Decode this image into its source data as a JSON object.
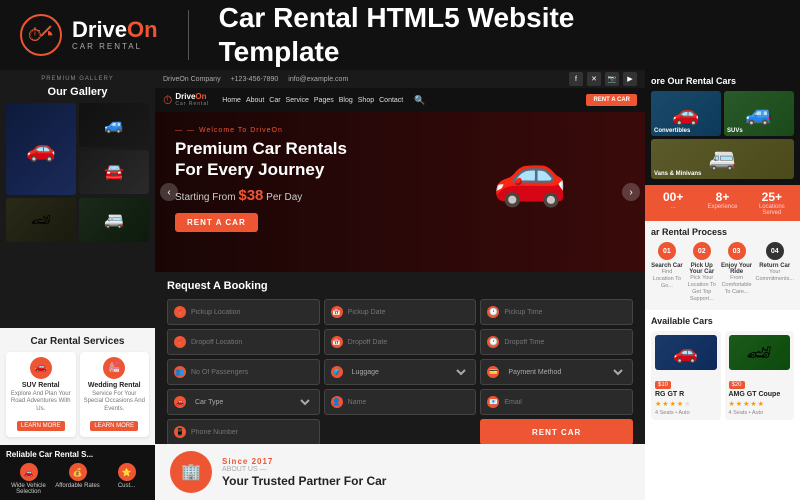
{
  "header": {
    "logo": {
      "drive": "Drive",
      "on": "On",
      "subtitle": "CAR RENTAL"
    },
    "title_line1": "Car Rental HTML5 Website",
    "title_line2": "Template"
  },
  "gallery": {
    "label": "PREMIUM GALLERY",
    "title": "Our Gallery"
  },
  "services": {
    "section_title": "Car Rental Services",
    "items": [
      {
        "icon": "🚗",
        "title": "SUV Rental",
        "desc": "Explore And Plan Your Road Adventures With Us.",
        "btn": "LEARN MORE"
      },
      {
        "icon": "💒",
        "title": "Wedding Rental",
        "desc": "Service For Your Special Occasions And Events.",
        "btn": "LEARN MORE"
      }
    ]
  },
  "reliable": {
    "title": "Reliable Car Rental S...",
    "features": [
      {
        "icon": "🚗",
        "label": "Wide Vehicle Selection"
      },
      {
        "icon": "💰",
        "label": "Affordable Rates"
      },
      {
        "icon": "🛠",
        "label": "Cust..."
      }
    ]
  },
  "mini_nav": {
    "company": "DriveOn Company",
    "phone": "+123-456-7890",
    "email": "info@example.com",
    "links": [
      "Home",
      "About",
      "Car",
      "Service",
      "Pages",
      "Blog",
      "Shop",
      "Contact"
    ],
    "rent_btn": "RENT A CAR",
    "logo_drive": "Drive",
    "logo_on": "On",
    "logo_sub": "Car Rental"
  },
  "hero": {
    "badge": "Welcome To DriveOn",
    "title": "Premium Car Rentals For Every Journey",
    "price_prefix": "Starting From",
    "price": "$38",
    "price_suffix": "Per Day",
    "btn": "RENT A CAR"
  },
  "booking": {
    "title": "Request A Booking",
    "fields": [
      {
        "icon": "📍",
        "placeholder": "Pickup Location"
      },
      {
        "icon": "📅",
        "placeholder": "Pickup Date"
      },
      {
        "icon": "🕐",
        "placeholder": "Pickup Time"
      },
      {
        "icon": "📍",
        "placeholder": "Dropoff Location"
      },
      {
        "icon": "📅",
        "placeholder": "Dropoff Date"
      },
      {
        "icon": "🕐",
        "placeholder": "Dropoff Time"
      },
      {
        "icon": "👥",
        "placeholder": "No Of Passengers"
      },
      {
        "icon": "🧳",
        "placeholder": "Luggage"
      },
      {
        "icon": "💳",
        "placeholder": "Payment Method"
      },
      {
        "icon": "🚗",
        "placeholder": "Car Type"
      },
      {
        "icon": "👤",
        "placeholder": "Name"
      },
      {
        "icon": "📧",
        "placeholder": "Email"
      },
      {
        "icon": "📱",
        "placeholder": "Phone Number"
      }
    ],
    "submit_btn": "RENT CAR"
  },
  "about": {
    "since_text": "Since 2017",
    "subtitle": "ABOUT US —",
    "heading": "Your Trusted Partner For Car",
    "icon": "🏢"
  },
  "explore": {
    "title": "ore Our Rental Cars",
    "car_types": [
      {
        "label": "Convertibles",
        "class": "car-type-convertible"
      },
      {
        "label": "SUVs",
        "class": "car-type-suv"
      },
      {
        "label": "Vans & Minivans",
        "class": "car-type-van"
      }
    ]
  },
  "stats": {
    "items": [
      {
        "number": "00+",
        "label": "..."
      },
      {
        "number": "8+",
        "label": "..."
      },
      {
        "number": "25+",
        "label": "Locations Served"
      }
    ]
  },
  "process": {
    "title": "ar Rental Process",
    "steps": [
      {
        "num": "01",
        "class": "p1",
        "title": "...",
        "desc": "..."
      },
      {
        "num": "02",
        "class": "p2",
        "title": "Pick Up Your Car",
        "desc": "Pick Your Location To Get Top Support..."
      },
      {
        "num": "03",
        "class": "p3",
        "title": "Enjoy Your Ride",
        "desc": "From Comfortable To Care..."
      },
      {
        "num": "04",
        "class": "p4",
        "title": "...",
        "desc": "..."
      }
    ]
  },
  "available": {
    "title": "Available Cars",
    "cars": [
      {
        "name": "RG GT R",
        "price": "$10",
        "stars": 4,
        "details": "4 Seats • Auto",
        "badge": "$10"
      },
      {
        "name": "AMG GT Coupe",
        "price": "$20",
        "stars": 5,
        "details": "4 Seats • Auto",
        "badge": "$20"
      }
    ]
  }
}
